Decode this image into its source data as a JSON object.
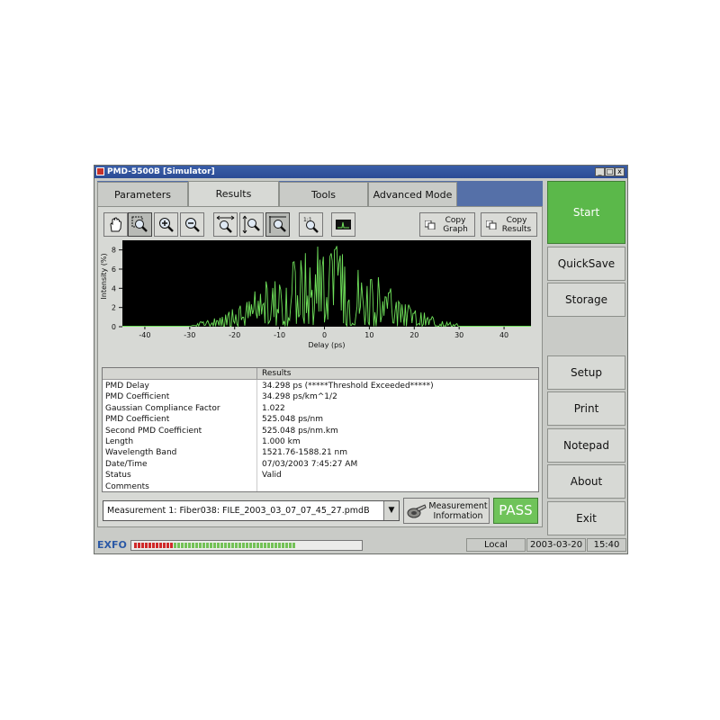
{
  "window": {
    "title": "PMD-5500B [Simulator]",
    "controls": {
      "minimize": "_",
      "maximize": "□",
      "close": "x"
    }
  },
  "tabs": [
    {
      "label": "Parameters",
      "active": false
    },
    {
      "label": "Results",
      "active": true
    },
    {
      "label": "Tools",
      "active": false
    },
    {
      "label": "Advanced Mode",
      "active": false
    }
  ],
  "toolbar": {
    "icons": [
      "hand-icon",
      "zoom-area-icon",
      "zoom-in-icon",
      "zoom-out-icon",
      "fit-horizontal-icon",
      "fit-vertical-icon",
      "fit-all-icon",
      "zoom-reset-icon",
      "graph-view-icon"
    ],
    "copy_graph_line1": "Copy",
    "copy_graph_line2": "Graph",
    "copy_results_line1": "Copy",
    "copy_results_line2": "Results"
  },
  "chart_data": {
    "type": "line",
    "xlabel": "Delay (ps)",
    "ylabel": "Intensity (%)",
    "xlim": [
      -45,
      46
    ],
    "ylim": [
      0,
      9
    ],
    "xticks": [
      -40,
      -30,
      -20,
      -10,
      0,
      10,
      20,
      30,
      40
    ],
    "yticks": [
      0,
      2,
      4,
      6,
      8
    ],
    "background": "#000000",
    "line_color": "#6fe05a",
    "series": [
      {
        "envelope_center": 0,
        "envelope_halfwidth": 30,
        "peak": 8.7
      }
    ]
  },
  "results": {
    "header": "Results",
    "rows": [
      {
        "key": "PMD Delay",
        "value": "34.298 ps (*****Threshold Exceeded*****)"
      },
      {
        "key": "PMD Coefficient",
        "value": "34.298 ps/km^1/2"
      },
      {
        "key": "Gaussian Compliance Factor",
        "value": "1.022"
      },
      {
        "key": "PMD Coefficient",
        "value": "525.048 ps/nm"
      },
      {
        "key": "Second PMD Coefficient",
        "value": "525.048 ps/nm.km"
      },
      {
        "key": "Length",
        "value": "1.000 km"
      },
      {
        "key": "Wavelength Band",
        "value": "1521.76-1588.21 nm"
      },
      {
        "key": "Date/Time",
        "value": "07/03/2003 7:45:27 AM"
      },
      {
        "key": "Status",
        "value": "Valid"
      },
      {
        "key": "Comments",
        "value": ""
      }
    ]
  },
  "measurement": {
    "selected": "Measurement   1: Fiber038: FILE_2003_03_07_07_45_27.pmdB",
    "info_line1": "Measurement",
    "info_line2": "Information",
    "pass_label": "PASS"
  },
  "side_buttons": {
    "start": "Start",
    "quicksave": "QuickSave",
    "storage": "Storage",
    "setup": "Setup",
    "print": "Print",
    "notepad": "Notepad",
    "about": "About",
    "exit": "Exit"
  },
  "statusbar": {
    "brand": "EXFO",
    "progress_red_segments": 11,
    "progress_green_segments": 34,
    "mode": "Local",
    "date": "2003-03-20",
    "time": "15:40"
  },
  "colors": {
    "start_green": "#5bb84a",
    "pass_green": "#6fc35a",
    "title_blue": "#2b4c95"
  }
}
